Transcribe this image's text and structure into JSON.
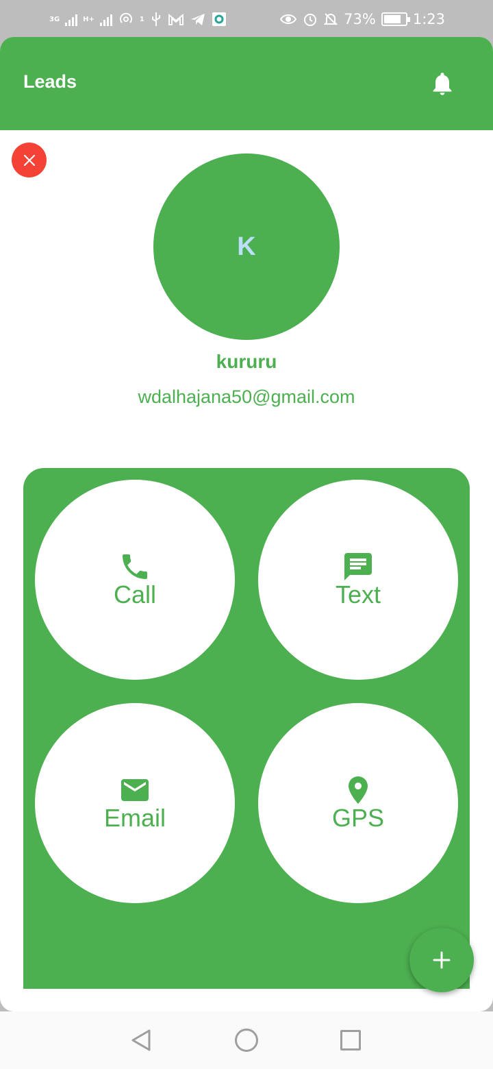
{
  "status_bar": {
    "network_1": "3G",
    "network_2": "H+",
    "hotspot_badge": "1",
    "battery_percent": "73%",
    "time": "1:23"
  },
  "app_bar": {
    "title": "Leads",
    "notification_icon": "bell-icon"
  },
  "lead": {
    "initial": "K",
    "name": "kururu",
    "email": "wdalhajana50@gmail.com"
  },
  "actions": [
    {
      "label": "Call",
      "icon": "phone-icon"
    },
    {
      "label": "Text",
      "icon": "message-icon"
    },
    {
      "label": "Email",
      "icon": "mail-icon"
    },
    {
      "label": "GPS",
      "icon": "location-pin-icon"
    }
  ],
  "colors": {
    "primary": "#4caf50",
    "close": "#f44336",
    "avatar_letter": "#bbdefb",
    "surface": "#ffffff"
  }
}
